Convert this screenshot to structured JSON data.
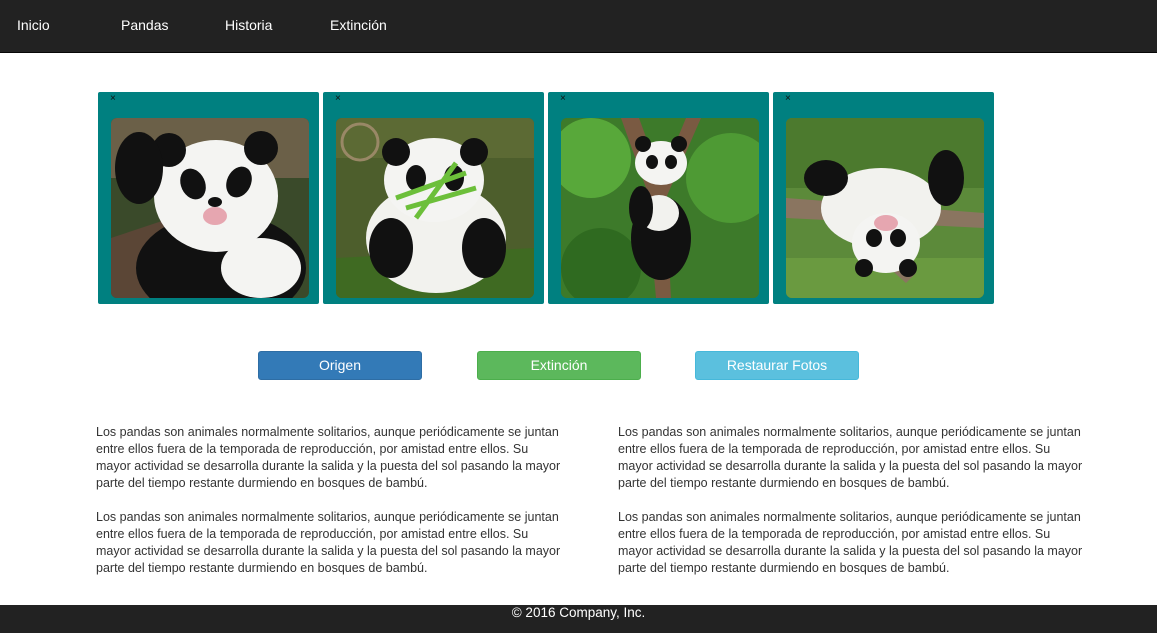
{
  "nav": {
    "items": [
      {
        "label": "Inicio"
      },
      {
        "label": "Pandas"
      },
      {
        "label": "Historia"
      },
      {
        "label": "Extinción"
      }
    ]
  },
  "gallery": {
    "close_label": "×",
    "photos": [
      {
        "subject": "panda-waving"
      },
      {
        "subject": "panda-eating-bamboo"
      },
      {
        "subject": "panda-climbing-tree"
      },
      {
        "subject": "panda-lying-on-branch"
      }
    ]
  },
  "buttons": {
    "origen": "Origen",
    "extincion": "Extinción",
    "restaurar": "Restaurar Fotos"
  },
  "content": {
    "left": {
      "p1": "Los pandas son animales normalmente solitarios, aunque periódicamente se juntan entre ellos fuera de la temporada de reproducción, por amistad entre ellos. Su mayor actividad se desarrolla durante la salida y la puesta del sol pasando la mayor parte del tiempo restante durmiendo en bosques de bambú.",
      "p2": "Los pandas son animales normalmente solitarios, aunque periódicamente se juntan entre ellos fuera de la temporada de reproducción, por amistad entre ellos. Su mayor actividad se desarrolla durante la salida y la puesta del sol pasando la mayor parte del tiempo restante durmiendo en bosques de bambú."
    },
    "right": {
      "p1": "Los pandas son animales normalmente solitarios, aunque periódicamente se juntan entre ellos fuera de la temporada de reproducción, por amistad entre ellos. Su mayor actividad se desarrolla durante la salida y la puesta del sol pasando la mayor parte del tiempo restante durmiendo en bosques de bambú.",
      "p2": "Los pandas son animales normalmente solitarios, aunque periódicamente se juntan entre ellos fuera de la temporada de reproducción, por amistad entre ellos. Su mayor actividad se desarrolla durante la salida y la puesta del sol pasando la mayor parte del tiempo restante durmiendo en bosques de bambú."
    }
  },
  "footer": {
    "text": "© 2016 Company, Inc."
  },
  "colors": {
    "navbar": "#222222",
    "card": "#008080",
    "btn_primary": "#337ab7",
    "btn_success": "#5cb85c",
    "btn_info": "#5bc0de"
  }
}
